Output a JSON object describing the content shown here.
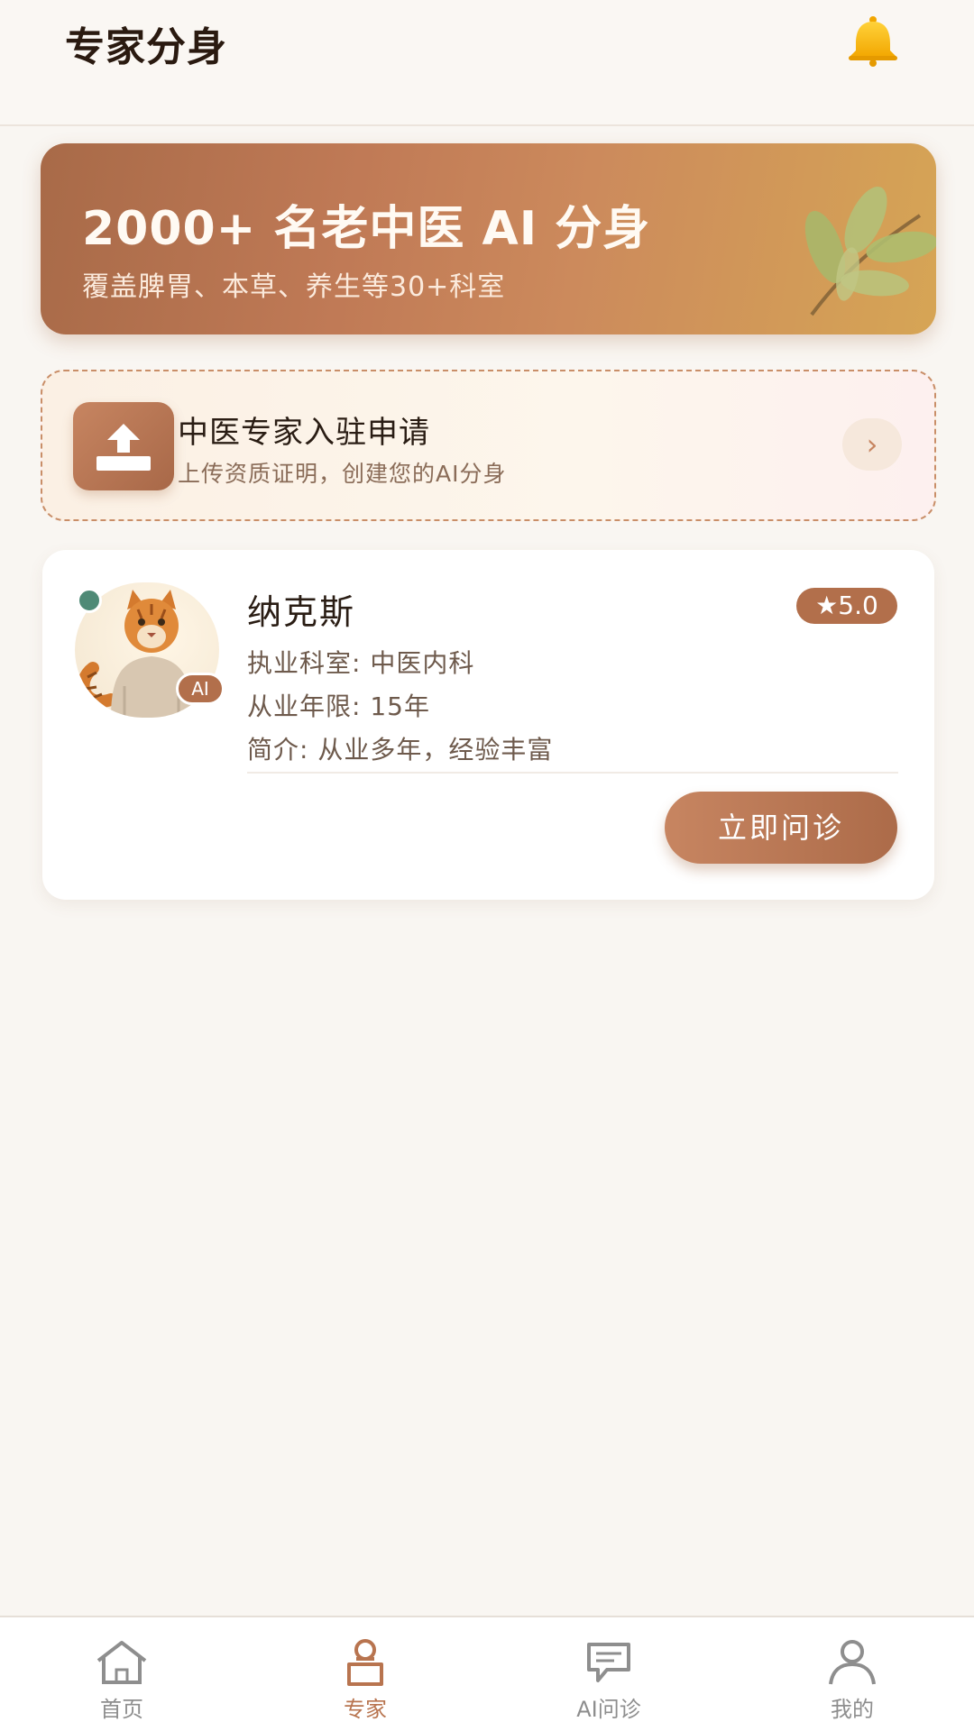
{
  "header": {
    "title": "专家分身",
    "bell_icon": "bell-icon"
  },
  "banner": {
    "title": "2000+ 名老中医 AI 分身",
    "subtitle": "覆盖脾胃、本草、养生等30+科室",
    "decoration_icon": "leaf-icon"
  },
  "apply": {
    "title": "中医专家入驻申请",
    "subtitle": "上传资质证明，创建您的AI分身",
    "arrow": "›",
    "icon": "upload-icon"
  },
  "expert": {
    "name": "纳克斯",
    "rating": "★5.0",
    "ai_badge": "AI",
    "department": "执业科室: 中医内科",
    "years": "从业年限: 15年",
    "intro": "简介: 从业多年，经验丰富",
    "consult_label": "立即问诊"
  },
  "tabbar": {
    "items": [
      {
        "label": "首页",
        "icon": "home-icon",
        "active": false
      },
      {
        "label": "专家",
        "icon": "expert-icon",
        "active": true
      },
      {
        "label": "AI问诊",
        "icon": "chat-icon",
        "active": false
      },
      {
        "label": "我的",
        "icon": "user-icon",
        "active": false
      }
    ]
  },
  "colors": {
    "accent": "#b26f4b",
    "background": "#f9f6f2",
    "online": "#4f8a76",
    "bell": "#f5b400"
  }
}
